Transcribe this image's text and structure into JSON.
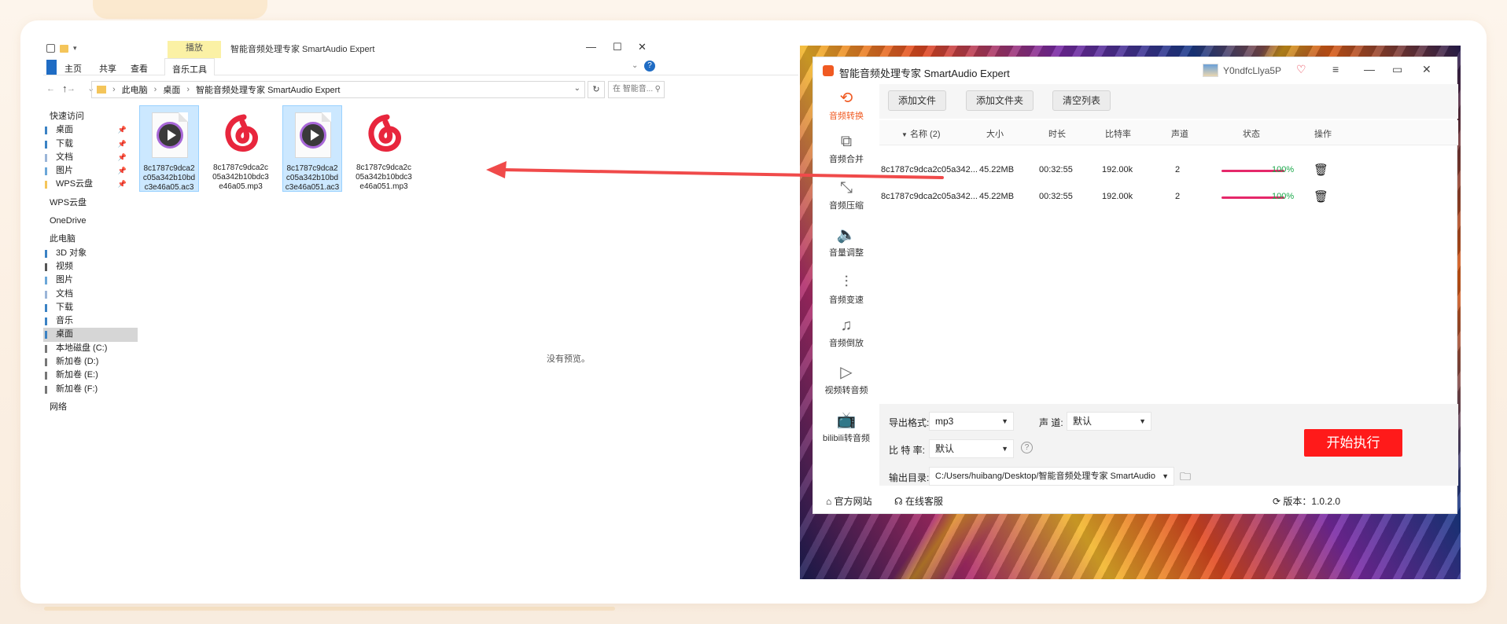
{
  "explorer": {
    "title": "智能音频处理专家 SmartAudio Expert",
    "context_tab": "播放",
    "ribbon_tabs": [
      "主页",
      "共享",
      "查看",
      "音乐工具"
    ],
    "window_controls": [
      "—",
      "☐",
      "✕"
    ],
    "nav_arrows": "← → ⌄",
    "breadcrumb": [
      "此电脑",
      "桌面",
      "智能音频处理专家 SmartAudio Expert"
    ],
    "search_placeholder": "在 智能音...",
    "nav": {
      "quick_access": "快速访问",
      "quick_items": [
        "桌面",
        "下载",
        "文档",
        "图片",
        "WPS云盘"
      ],
      "wps": "WPS云盘",
      "onedrive": "OneDrive",
      "this_pc": "此电脑",
      "pc_items": [
        "3D 对象",
        "视频",
        "图片",
        "文档",
        "下载",
        "音乐",
        "桌面",
        "本地磁盘 (C:)",
        "新加卷 (D:)",
        "新加卷 (E:)",
        "新加卷 (F:)"
      ],
      "network": "网络"
    },
    "files": [
      {
        "name": "8c1787c9dca2c05a342b10bdc3e46a05.ac3",
        "type": "ac3",
        "selected": true
      },
      {
        "name": "8c1787c9dca2c05a342b10bdc3e46a05.mp3",
        "type": "netease",
        "selected": false
      },
      {
        "name": "8c1787c9dca2c05a342b10bdc3e46a051.ac3",
        "type": "ac3",
        "selected": true
      },
      {
        "name": "8c1787c9dca2c05a342b10bdc3e46a051.mp3",
        "type": "netease",
        "selected": false
      }
    ],
    "no_preview": "没有预览。"
  },
  "app": {
    "title": "智能音频处理专家 SmartAudio Expert",
    "username": "Y0ndfcLlya5P",
    "sidebar": [
      {
        "label": "音频转换",
        "icon": "⟲",
        "active": true
      },
      {
        "label": "音频合并",
        "icon": "⧉",
        "active": false
      },
      {
        "label": "音频压缩",
        "icon": "⤡",
        "active": false
      },
      {
        "label": "音量调整",
        "icon": "🔈",
        "active": false
      },
      {
        "label": "音频变速",
        "icon": "⫶",
        "active": false
      },
      {
        "label": "音频倒放",
        "icon": "♫",
        "active": false
      },
      {
        "label": "视频转音频",
        "icon": "▷",
        "active": false
      },
      {
        "label": "bilibili转音频",
        "icon": "📺",
        "active": false
      }
    ],
    "toolbar": {
      "add_file": "添加文件",
      "add_folder": "添加文件夹",
      "clear_list": "清空列表"
    },
    "table": {
      "headers": [
        "名称 (2)",
        "大小",
        "时长",
        "比特率",
        "声道",
        "状态",
        "操作"
      ],
      "rows": [
        {
          "name": "8c1787c9dca2c05a342...",
          "size": "45.22MB",
          "duration": "00:32:55",
          "bitrate": "192.00k",
          "channels": "2",
          "progress": "100%"
        },
        {
          "name": "8c1787c9dca2c05a342...",
          "size": "45.22MB",
          "duration": "00:32:55",
          "bitrate": "192.00k",
          "channels": "2",
          "progress": "100%"
        }
      ]
    },
    "settings": {
      "format_label": "导出格式:",
      "format_value": "mp3",
      "channel_label": "声 道:",
      "channel_value": "默认",
      "bitrate_label": "比 特 率:",
      "bitrate_value": "默认",
      "output_label": "输出目录:",
      "output_value": "C:/Users/huibang/Desktop/智能音频处理专家 SmartAudio"
    },
    "run_button": "开始执行",
    "footer": {
      "website": "官方网站",
      "support": "在线客服",
      "version": "版本：1.0.2.0"
    }
  },
  "colors": {
    "accent": "#f05a22",
    "run": "#ff1a1a",
    "progress": "#e5286a",
    "ok": "#1aa84a",
    "netease": "#e8263d"
  }
}
